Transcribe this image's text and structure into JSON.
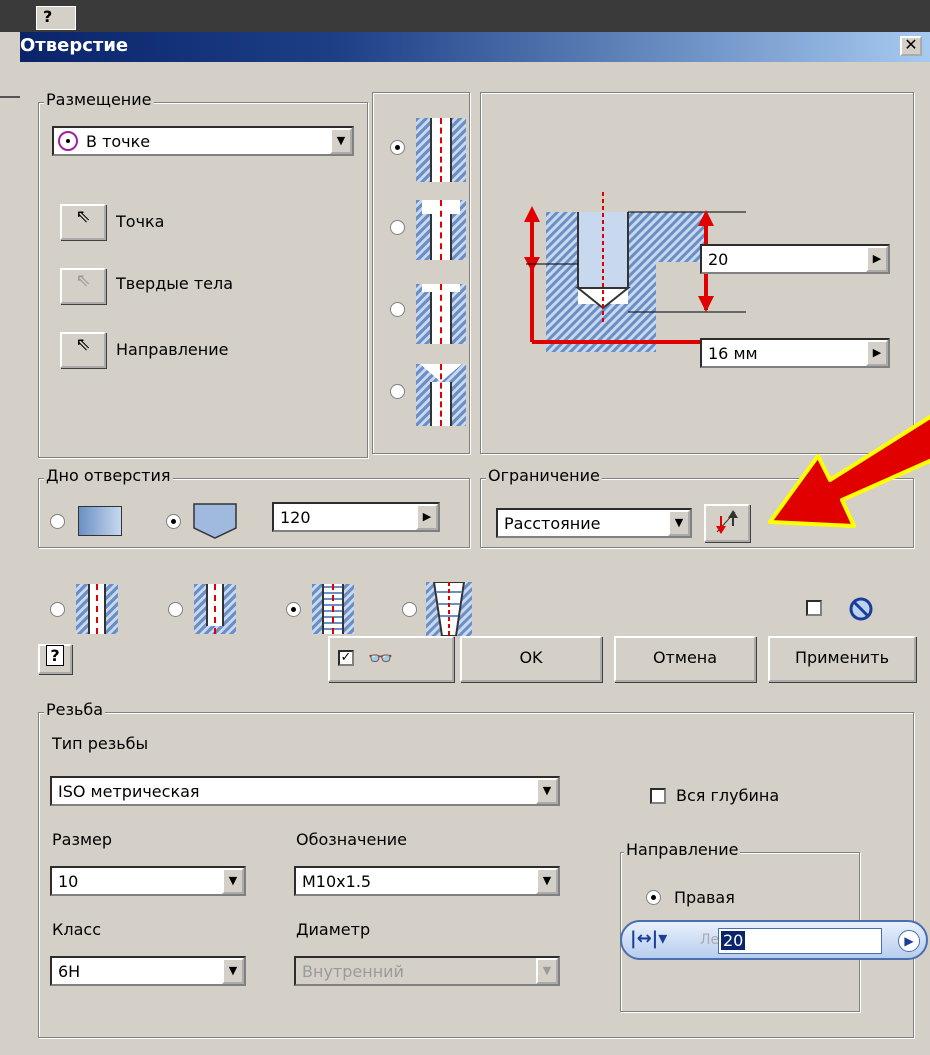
{
  "window": {
    "title": "Отверстие",
    "close_glyph": "✕",
    "topbar_fragment": "?"
  },
  "placement": {
    "group_label": "Размещение",
    "mode_value": "В точке",
    "point_label": "Точка",
    "solids_label": "Твердые тела",
    "direction_label": "Направление"
  },
  "preview": {
    "depth_value": "20",
    "diameter_value": "16 мм"
  },
  "bottom": {
    "group_label": "Дно отверстия",
    "angle_value": "120"
  },
  "limit": {
    "group_label": "Ограничение",
    "value": "Расстояние"
  },
  "actions": {
    "ok": "OK",
    "cancel": "Отмена",
    "apply": "Применить",
    "help_glyph": "?"
  },
  "thread": {
    "group_label": "Резьба",
    "type_label": "Тип резьбы",
    "type_value": "ISO метрическая",
    "full_depth_label": "Вся глубина",
    "size_label": "Размер",
    "size_value": "10",
    "designation_label": "Обозначение",
    "designation_value": "M10x1.5",
    "class_label": "Класс",
    "class_value": "6H",
    "diameter_label": "Диаметр",
    "diameter_value": "Внутренний",
    "direction_group_label": "Направление",
    "right_label": "Правая",
    "left_fragment": "Лев",
    "mini_value": "20"
  },
  "colors": {
    "accent_red": "#e00000",
    "arrow_yellow": "#ffff00",
    "title_blue": "#0a246a"
  }
}
